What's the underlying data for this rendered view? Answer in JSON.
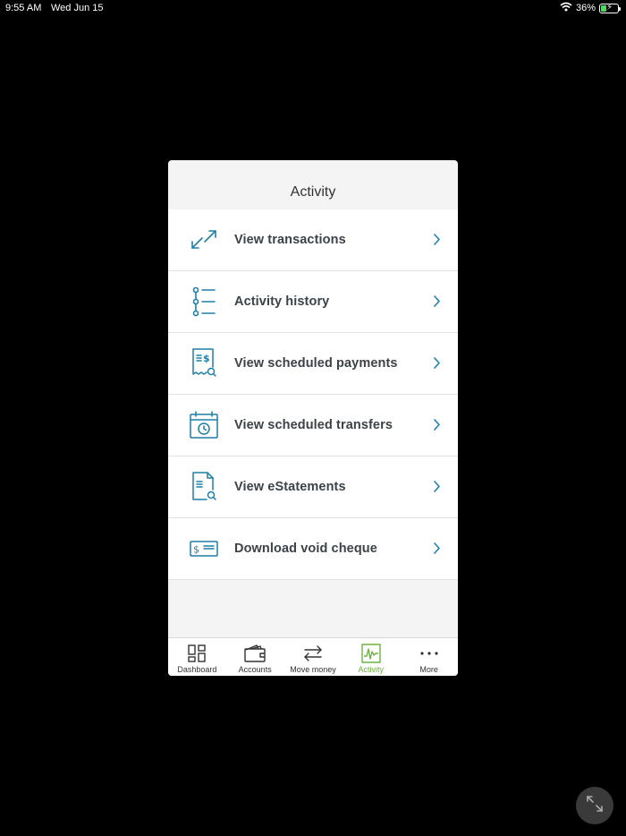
{
  "status_bar": {
    "time": "9:55 AM",
    "date": "Wed Jun 15",
    "battery": "36%",
    "battery_level": 0.36
  },
  "header": {
    "title": "Activity"
  },
  "menu": {
    "items": [
      {
        "label": "View transactions",
        "icon": "arrows-diagonal-icon"
      },
      {
        "label": "Activity history",
        "icon": "timeline-list-icon"
      },
      {
        "label": "View scheduled payments",
        "icon": "receipt-search-icon"
      },
      {
        "label": "View scheduled transfers",
        "icon": "calendar-clock-icon"
      },
      {
        "label": "View eStatements",
        "icon": "document-search-icon"
      },
      {
        "label": "Download void cheque",
        "icon": "cheque-icon"
      }
    ]
  },
  "tabs": [
    {
      "label": "Dashboard",
      "icon": "grid-icon",
      "active": false
    },
    {
      "label": "Accounts",
      "icon": "wallet-icon",
      "active": false
    },
    {
      "label": "Move money",
      "icon": "transfer-arrows-icon",
      "active": false
    },
    {
      "label": "Activity",
      "icon": "activity-chart-icon",
      "active": true
    },
    {
      "label": "More",
      "icon": "more-dots-icon",
      "active": false
    }
  ],
  "colors": {
    "accent": "#1f7fa6",
    "active_tab": "#6cb33f",
    "label_text": "#3b4248"
  }
}
